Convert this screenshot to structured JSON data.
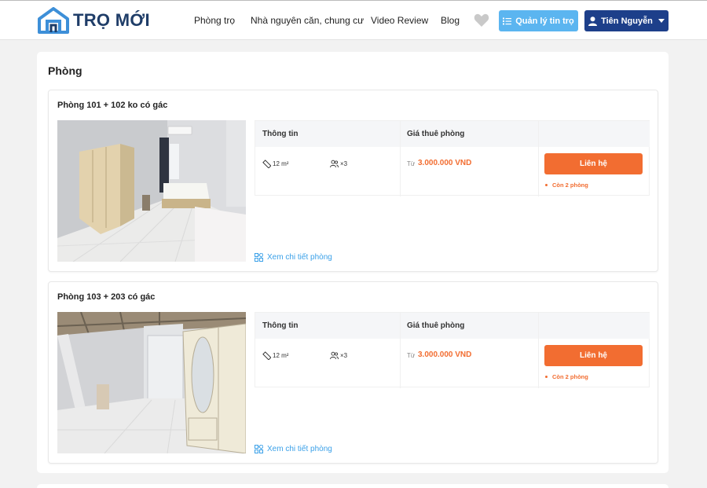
{
  "brand": {
    "name": "TRỌ MỚI"
  },
  "nav": {
    "items": [
      "Phòng trọ",
      "Nhà nguyên căn, chung cư",
      "Video Review",
      "Blog"
    ],
    "manage_label": "Quản lý tin trọ",
    "user_label": "Tiên Nguyễn"
  },
  "section": {
    "title": "Phòng"
  },
  "table_headers": {
    "info": "Thông tin",
    "price": "Giá thuê phòng"
  },
  "rooms": [
    {
      "title": "Phòng 101 + 102 ko có gác",
      "area": "12 m²",
      "capacity": "×3",
      "price_prefix": "Từ",
      "price": "3.000.000 VND",
      "contact_label": "Liên hệ",
      "remaining": "Còn 2 phòng",
      "detail_link": "Xem chi tiết phòng"
    },
    {
      "title": "Phòng 103 + 203 có gác",
      "area": "12 m²",
      "capacity": "×3",
      "price_prefix": "Từ",
      "price": "3.000.000 VND",
      "contact_label": "Liên hệ",
      "remaining": "Còn 2 phòng",
      "detail_link": "Xem chi tiết phòng"
    }
  ],
  "colors": {
    "accent": "#f26d31",
    "primary": "#1d3f8a",
    "light_blue": "#5bb5f0",
    "link": "#3aa0e8"
  },
  "icons": [
    "house-logo-icon",
    "heart-icon",
    "list-icon",
    "user-icon",
    "ruler-icon",
    "people-icon",
    "grid-icon"
  ]
}
